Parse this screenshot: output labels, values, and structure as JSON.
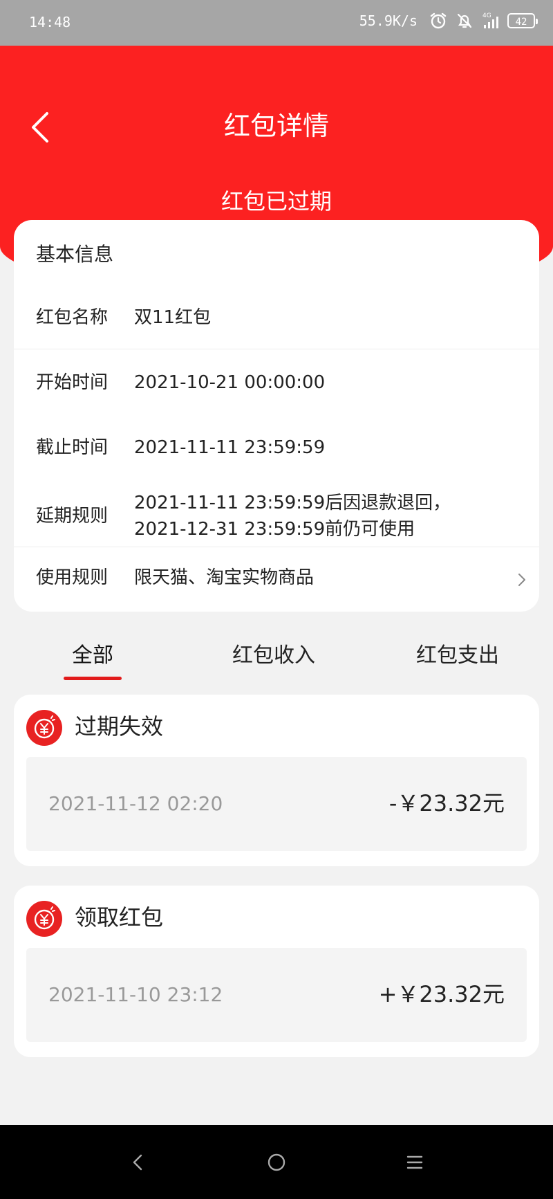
{
  "status_bar": {
    "time": "14:48",
    "net_speed": "55.9K/s",
    "signal": "4G",
    "battery": "42"
  },
  "header": {
    "title": "红包详情",
    "status": "红包已过期",
    "accent_color": "#fc2121"
  },
  "basic_info": {
    "section_title": "基本信息",
    "rows": [
      {
        "label": "红包名称",
        "value": "双11红包"
      },
      {
        "label": "开始时间",
        "value": "2021-10-21 00:00:00"
      },
      {
        "label": "截止时间",
        "value": "2021-11-11 23:59:59"
      },
      {
        "label": "延期规则",
        "value_line1": "2021-11-11 23:59:59后因退款退回，",
        "value_line2": "2021-12-31 23:59:59前仍可使用"
      },
      {
        "label": "使用规则",
        "value": "限天猫、淘宝实物商品"
      }
    ]
  },
  "tabs": [
    {
      "label": "全部",
      "active": true
    },
    {
      "label": "红包收入",
      "active": false
    },
    {
      "label": "红包支出",
      "active": false
    }
  ],
  "records": [
    {
      "title": "过期失效",
      "time": "2021-11-12 02:20",
      "amount": "-￥23.32元",
      "icon": "yuan-coin-icon"
    },
    {
      "title": "领取红包",
      "time": "2021-11-10 23:12",
      "amount": "+￥23.32元",
      "icon": "yuan-coin-icon"
    }
  ]
}
